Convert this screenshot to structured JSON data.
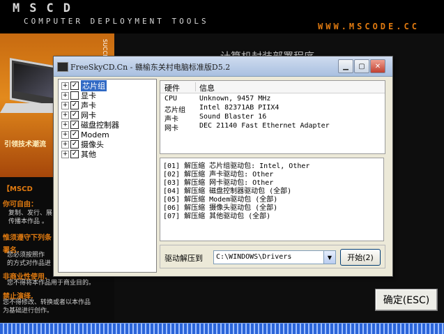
{
  "background": {
    "brand": "MSCD",
    "brand_sub": "COMPUTER DEPLOYMENT TOOLS",
    "website": "WWW.MSCODE.CC",
    "title": "计算机封装部署程序",
    "side_tagline": "引领技术潮流",
    "side_vertical": "SUCCESS DATA",
    "side_sections": [
      {
        "head": "【MSCD",
        "text": ""
      },
      {
        "head": "你可自由：",
        "text": "复制、发行、展\n传播本作品 。"
      },
      {
        "head": "惟须遵守下列条",
        "text": ""
      },
      {
        "head": "署名.",
        "text": "您必须按照作\n的方式对作品进"
      },
      {
        "head": "非商业性使用.",
        "text": "您不得将本作品用于商业目的。"
      },
      {
        "head": "禁止演绎.",
        "text": "您不得修改、转换或者以本作品\n为基础进行创作。"
      }
    ],
    "ok_label": "确定(ESC)"
  },
  "dialog": {
    "title": "FreeSkyCD.Cn - 赣榆东关村电脑标准版D5.2",
    "tree": [
      {
        "label": "芯片组",
        "checked": true,
        "selected": true
      },
      {
        "label": "显卡",
        "checked": false,
        "selected": false
      },
      {
        "label": "声卡",
        "checked": true,
        "selected": false
      },
      {
        "label": "网卡",
        "checked": true,
        "selected": false
      },
      {
        "label": "磁盘控制器",
        "checked": true,
        "selected": false
      },
      {
        "label": "Modem",
        "checked": true,
        "selected": false
      },
      {
        "label": "摄像头",
        "checked": true,
        "selected": false
      },
      {
        "label": "其他",
        "checked": true,
        "selected": false
      }
    ],
    "hw_columns": [
      "硬件",
      "信息"
    ],
    "hw_rows": [
      [
        "CPU",
        "Unknown, 9457 MHz"
      ],
      [
        "芯片组",
        "Intel 82371AB PIIX4"
      ],
      [
        "声卡",
        "Sound Blaster 16"
      ],
      [
        "网卡",
        "DEC 21140 Fast Ethernet Adapter"
      ]
    ],
    "log_lines": [
      "[01] 解压缩 芯片组驱动包: Intel, Other",
      "[02] 解压缩 声卡驱动包: Other",
      "[03] 解压缩 网卡驱动包: Other",
      "[04] 解压缩 磁盘控制器驱动包 (全部)",
      "[05] 解压缩 Modem驱动包 (全部)",
      "[06] 解压缩 摄像头驱动包 (全部)",
      "[07] 解压缩 其他驱动包 (全部)"
    ],
    "extract_label": "驱动解压到",
    "extract_path": "C:\\WINDOWS\\Drivers",
    "start_label": "开始(2)"
  }
}
